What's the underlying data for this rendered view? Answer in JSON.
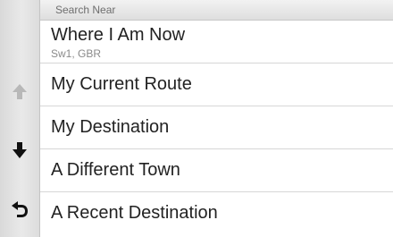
{
  "header": {
    "label": "Search Near"
  },
  "side_nav": {
    "up_icon": "arrow-up-icon",
    "up_state": "disabled",
    "down_icon": "arrow-down-icon",
    "back_icon": "back-arrow-icon"
  },
  "list": {
    "items": [
      {
        "title": "Where I Am Now",
        "subtitle": "Sw1, GBR"
      },
      {
        "title": "My Current Route"
      },
      {
        "title": "My Destination"
      },
      {
        "title": "A Different Town"
      },
      {
        "title": "A Recent Destination"
      }
    ]
  },
  "colors": {
    "sidebar": "#e2e2e2",
    "header": "#e6e6e6",
    "text": "#222222",
    "disabled_arrow": "#b8b8b8",
    "active_arrow": "#111111"
  }
}
